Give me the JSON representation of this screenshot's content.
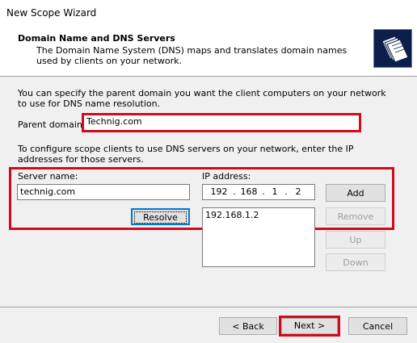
{
  "window": {
    "title": "New Scope Wizard"
  },
  "header": {
    "title": "Domain Name and DNS Servers",
    "description": "The Domain Name System (DNS) maps and translates domain names used by clients on your network."
  },
  "intro_text": "You can specify the parent domain you want the client computers on your network to use for DNS name resolution.",
  "parent_domain": {
    "label": "Parent domain:",
    "value": "Technig.com"
  },
  "scope_text": "To configure scope clients to use DNS servers on your network, enter the IP addresses for those servers.",
  "server_name": {
    "label": "Server name:",
    "value": "technig.com"
  },
  "ip_address": {
    "label": "IP address:",
    "octets": [
      "192",
      "168",
      "1",
      "2"
    ],
    "dot": "."
  },
  "resolve_button": "Resolve",
  "ip_list": [
    "192.168.1.2"
  ],
  "list_buttons": {
    "add": "Add",
    "remove": "Remove",
    "up": "Up",
    "down": "Down"
  },
  "footer": {
    "back": "< Back",
    "next": "Next >",
    "cancel": "Cancel"
  },
  "colors": {
    "highlight": "#d10a1e",
    "header_bg": "#ffffff",
    "dialog_bg": "#f0f0f0",
    "icon_bg": "#0c1e4a"
  },
  "icons": {
    "wizard": "documents-stack-icon"
  }
}
